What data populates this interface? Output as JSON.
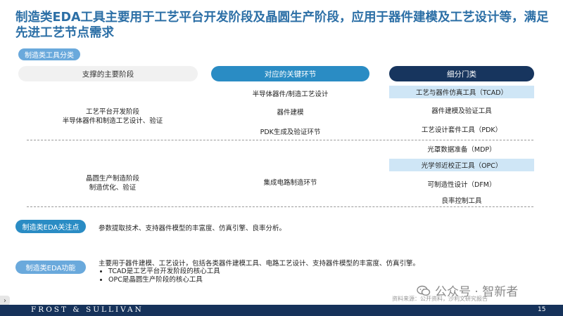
{
  "title": "制造类EDA工具主要用于工艺平台开发阶段及晶圆生产阶段，应用于器件建模及工艺设计等，满足先进工艺节点需求",
  "category_pill": "制造类工具分类",
  "headers": {
    "stages": "支撑的主要阶段",
    "links": "对应的关键环节",
    "segments": "细分门类"
  },
  "stages": {
    "stage1": {
      "line1": "工艺平台开发阶段",
      "line2": "半导体器件和制造工艺设计、验证"
    },
    "stage2": {
      "line1": "晶圆生产制造阶段",
      "line2": "制造优化、验证"
    }
  },
  "links": {
    "l1": "半导体器件/制造工艺设计",
    "l2": "器件建模",
    "l3": "PDK生成及验证环节",
    "l4": "集成电路制造环节"
  },
  "segments": [
    {
      "label": "工艺与器件仿真工具（TCAD）",
      "highlight": true
    },
    {
      "label": "器件建模及验证工具",
      "highlight": false
    },
    {
      "label": "工艺设计套件工具（PDK）",
      "highlight": false
    },
    {
      "label": "光罩数据准备（MDP）",
      "highlight": false
    },
    {
      "label": "光学邻近校正工具（OPC）",
      "highlight": true
    },
    {
      "label": "可制造性设计（DFM）",
      "highlight": false
    },
    {
      "label": "良率控制工具",
      "highlight": false
    }
  ],
  "focus": {
    "pill": "制造类EDA关注点",
    "text": "参数提取技术、支持器件模型的丰富度、仿真引擎、良率分析。"
  },
  "function": {
    "pill": "制造类EDA功能",
    "text": "主要用于器件建模、工艺设计，包括各类器件建模工具、电路工艺设计、支持器件模型的丰富度、仿真引擎。",
    "bullets": [
      "TCAD是工艺平台开发阶段的核心工具",
      "OPC是晶圆生产阶段的核心工具"
    ]
  },
  "watermark": "公众号 · 智新者",
  "source": "资料来源：公开资料，沙利文研究报告",
  "footer": {
    "logo": "FROST & SULLIVAN",
    "page": "15"
  },
  "colors": {
    "title": "#2c6fa6",
    "accent": "#2a8cc4",
    "navy": "#17355e",
    "highlight": "#cfe6f6"
  }
}
